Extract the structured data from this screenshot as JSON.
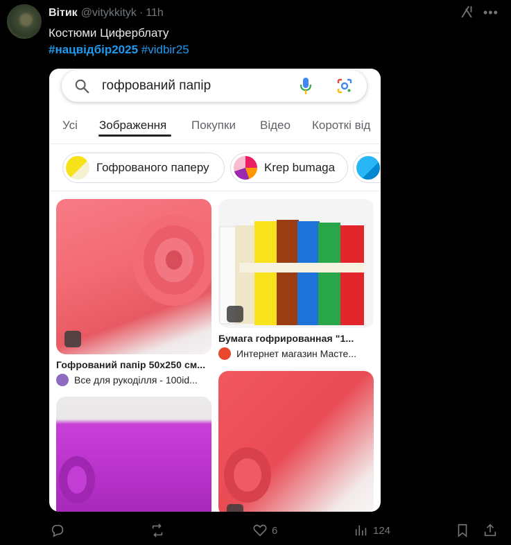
{
  "tweet": {
    "author": "Вітик",
    "handle": "@vitykkityk",
    "time": "11h",
    "text": "Костюми Циферблату",
    "hashtag1": "#нацвідбір2025",
    "hashtag2": "#vidbir25"
  },
  "search": {
    "query": "гофрований папір"
  },
  "tabs": [
    "Усі",
    "Зображення",
    "Покупки",
    "Відео",
    "Короткі від"
  ],
  "chips": [
    "Гофрованого паперу",
    "Krep bumaga"
  ],
  "results": [
    {
      "title": "Гофрований папір 50x250 см...",
      "source": "Все для рукоділля - 100id..."
    },
    {
      "title": "Бумага гофрированная \"1...",
      "source": "Интернет магазин Масте..."
    }
  ],
  "actions": {
    "likes": "6",
    "views": "124"
  },
  "colors": {
    "accent": "#1d9bf0",
    "muted": "#71767b",
    "background": "#000000"
  }
}
